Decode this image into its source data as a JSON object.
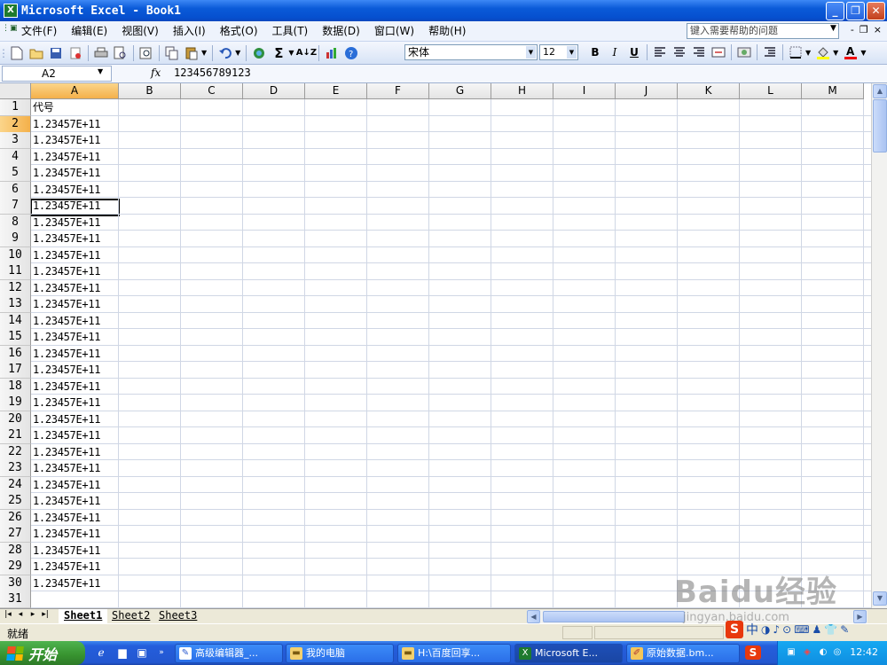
{
  "window": {
    "title": "Microsoft Excel - Book1",
    "app_icon": "X",
    "min_label": "_",
    "max_label": "❐",
    "close_label": "✕"
  },
  "menu": {
    "items": [
      "文件(F)",
      "编辑(E)",
      "视图(V)",
      "插入(I)",
      "格式(O)",
      "工具(T)",
      "数据(D)",
      "窗口(W)",
      "帮助(H)"
    ],
    "help_placeholder": "键入需要帮助的问题",
    "right_controls": [
      "-",
      "❐",
      "×"
    ]
  },
  "toolbar": {
    "icons": [
      "new-icon",
      "open-icon",
      "save-icon",
      "permission-icon",
      "print-icon",
      "print-preview-icon",
      "research-icon",
      "copy-icon",
      "paste-icon",
      "undo-icon",
      "hyperlink-icon",
      "autosum-icon",
      "sort-icon",
      "chart-icon",
      "help-icon"
    ],
    "font_name": "宋体",
    "font_size": "12",
    "bold": "B",
    "italic": "I",
    "underline": "U"
  },
  "formula_bar": {
    "name_box": "A2",
    "fx": "fx",
    "value": "123456789123"
  },
  "sheet": {
    "columns": [
      "A",
      "B",
      "C",
      "D",
      "E",
      "F",
      "G",
      "H",
      "I",
      "J",
      "K",
      "L",
      "M"
    ],
    "selected_column": "A",
    "selected_row": "2",
    "rows": [
      "1",
      "2",
      "3",
      "4",
      "5",
      "6",
      "7",
      "8",
      "9",
      "10",
      "11",
      "12",
      "13",
      "14",
      "15",
      "16",
      "17",
      "18",
      "19",
      "20",
      "21",
      "22",
      "23",
      "24",
      "25",
      "26",
      "27",
      "28",
      "29",
      "30",
      "31"
    ],
    "col_a_values": [
      "代号",
      "1.23457E+11",
      "1.23457E+11",
      "1.23457E+11",
      "1.23457E+11",
      "1.23457E+11",
      "1.23457E+11",
      "1.23457E+11",
      "1.23457E+11",
      "1.23457E+11",
      "1.23457E+11",
      "1.23457E+11",
      "1.23457E+11",
      "1.23457E+11",
      "1.23457E+11",
      "1.23457E+11",
      "1.23457E+11",
      "1.23457E+11",
      "1.23457E+11",
      "1.23457E+11",
      "1.23457E+11",
      "1.23457E+11",
      "1.23457E+11",
      "1.23457E+11",
      "1.23457E+11",
      "1.23457E+11",
      "1.23457E+11",
      "1.23457E+11",
      "1.23457E+11",
      "1.23457E+11",
      ""
    ]
  },
  "tabs": [
    "Sheet1",
    "Sheet2",
    "Sheet3"
  ],
  "active_tab": "Sheet1",
  "status": {
    "text": "就绪"
  },
  "taskbar": {
    "start_label": "开始",
    "buttons": [
      {
        "label": "高级编辑器_...",
        "icon": "editor-icon"
      },
      {
        "label": "我的电脑",
        "icon": "folder-icon"
      },
      {
        "label": "H:\\百度回享...",
        "icon": "folder-icon"
      },
      {
        "label": "Microsoft E...",
        "icon": "excel-icon"
      },
      {
        "label": "原始数据.bm...",
        "icon": "paint-icon"
      }
    ],
    "clock": "12:42"
  },
  "ime": {
    "logo": "S",
    "mode": "中"
  },
  "watermark": {
    "main": "Baidu经验",
    "sub": "jingyan.baidu.com"
  }
}
